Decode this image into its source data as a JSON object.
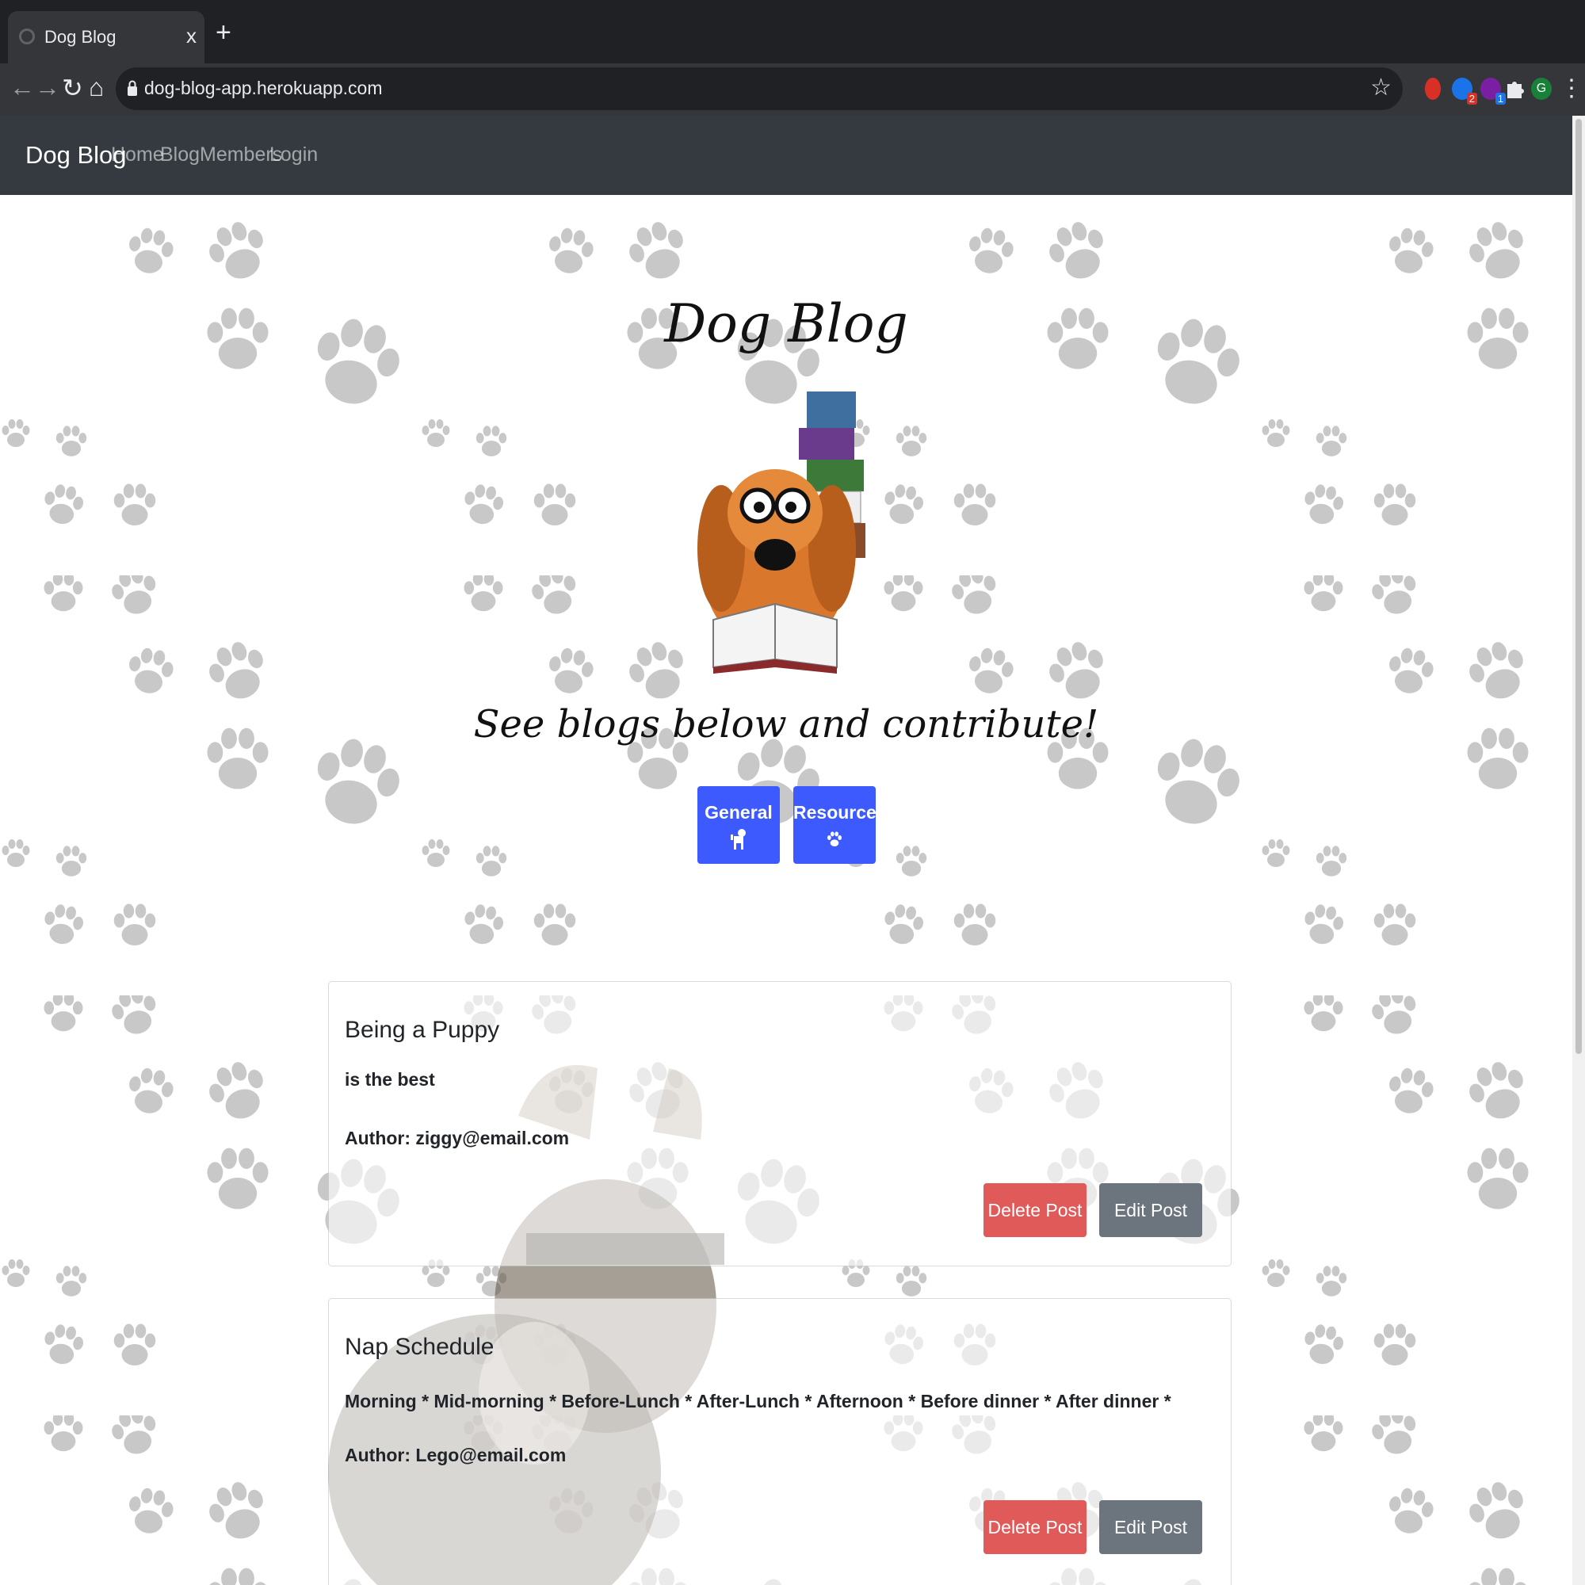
{
  "browser": {
    "tab_title": "Dog Blog",
    "tab_close": "x",
    "new_tab": "+",
    "url": "dog-blog-app.herokuapp.com",
    "extensions": [
      {
        "name": "red-extension-icon",
        "color": "#d93025",
        "badge": ""
      },
      {
        "name": "blue-extension-icon",
        "color": "#1a73e8",
        "badge": "2"
      },
      {
        "name": "purple-extension-icon",
        "color": "#7b1fa2",
        "badge": "1"
      },
      {
        "name": "puzzle-extensions-icon",
        "color": "#9aa0a6",
        "badge": ""
      },
      {
        "name": "profile-avatar-icon",
        "color": "#188038",
        "badge": ""
      }
    ],
    "profile_initial": "G"
  },
  "site_nav": {
    "brand": "Dog Blog",
    "links": [
      "Home",
      "Blog",
      "Members",
      "Login"
    ]
  },
  "hero": {
    "title": "Dog Blog",
    "image_icon": "reading-dog-illustration",
    "subtitle": "See blogs below and contribute!"
  },
  "categories": [
    {
      "label": "General",
      "icon": "dog-icon"
    },
    {
      "label": "Resources",
      "icon": "paw-icon"
    }
  ],
  "posts": [
    {
      "title": "Being a Puppy",
      "body": "is the best",
      "author": "Author: ziggy@email.com",
      "delete_label": "Delete Post",
      "edit_label": "Edit Post"
    },
    {
      "title": "Nap Schedule",
      "body": "Morning * Mid-morning * Before-Lunch * After-Lunch * Afternoon * Before dinner * After dinner *",
      "author": "Author: Lego@email.com",
      "delete_label": "Delete Post",
      "edit_label": "Edit Post"
    }
  ],
  "colors": {
    "primary": "#3d5afe",
    "danger": "#e05a5a",
    "secondary": "#6c757d",
    "navbar": "#343a40",
    "paw": "#c8c8c8"
  }
}
